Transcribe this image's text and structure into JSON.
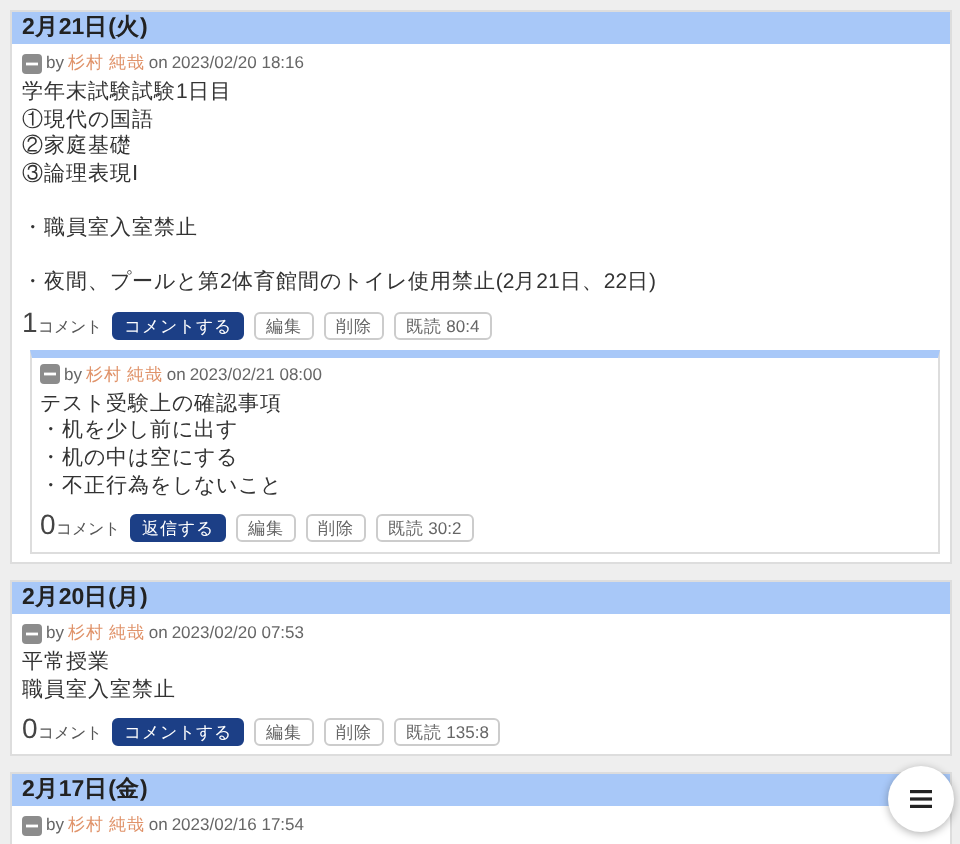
{
  "posts": [
    {
      "date": "2月21日(火)",
      "author": "杉村 純哉",
      "by": "by",
      "on": "on",
      "timestamp": "2023/02/20 18:16",
      "paragraphs": [
        [
          "学年末試験試験1日目",
          "①現代の国語",
          "②家庭基礎",
          "③論理表現Ⅰ"
        ],
        [
          "・職員室入室禁止"
        ],
        [
          "・夜間、プールと第2体育館間のトイレ使用禁止(2月21日、22日)"
        ]
      ],
      "comment_count": "1",
      "comment_label": "コメント",
      "buttons": [
        {
          "label": "コメントする",
          "kind": "primary"
        },
        {
          "label": "編集",
          "kind": "plain"
        },
        {
          "label": "削除",
          "kind": "plain"
        },
        {
          "label": "既読 80:4",
          "kind": "plain"
        }
      ],
      "replies": [
        {
          "author": "杉村 純哉",
          "by": "by",
          "on": "on",
          "timestamp": "2023/02/21 08:00",
          "paragraphs": [
            [
              "テスト受験上の確認事項",
              "・机を少し前に出す",
              "・机の中は空にする",
              "・不正行為をしないこと"
            ]
          ],
          "comment_count": "0",
          "comment_label": "コメント",
          "buttons": [
            {
              "label": "返信する",
              "kind": "primary"
            },
            {
              "label": "編集",
              "kind": "plain"
            },
            {
              "label": "削除",
              "kind": "plain"
            },
            {
              "label": "既読 30:2",
              "kind": "plain"
            }
          ]
        }
      ]
    },
    {
      "date": "2月20日(月)",
      "author": "杉村 純哉",
      "by": "by",
      "on": "on",
      "timestamp": "2023/02/20 07:53",
      "paragraphs": [
        [
          "平常授業",
          "職員室入室禁止"
        ]
      ],
      "comment_count": "0",
      "comment_label": "コメント",
      "buttons": [
        {
          "label": "コメントする",
          "kind": "primary"
        },
        {
          "label": "編集",
          "kind": "plain"
        },
        {
          "label": "削除",
          "kind": "plain"
        },
        {
          "label": "既読 135:8",
          "kind": "plain"
        }
      ]
    },
    {
      "date": "2月17日(金)",
      "author": "杉村 純哉",
      "by": "by",
      "on": "on",
      "timestamp": "2023/02/16 17:54"
    }
  ]
}
